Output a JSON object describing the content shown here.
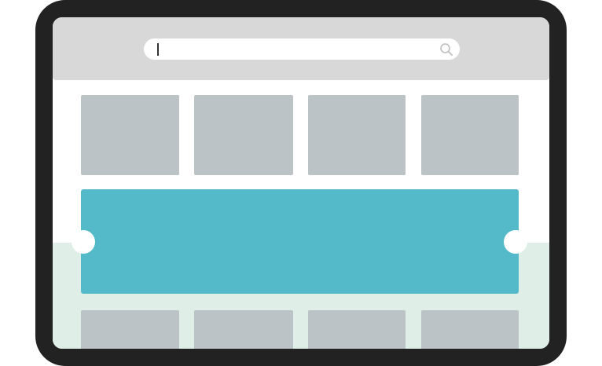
{
  "search": {
    "value": "",
    "placeholder": ""
  },
  "icons": {
    "search": "search-icon"
  },
  "colors": {
    "device_frame": "#222222",
    "header": "#d8d8d8",
    "tile": "#bcc3c6",
    "banner": "#54b9c9",
    "bottom_band": "#dfeee6"
  },
  "grid": {
    "top_row_tiles": 4,
    "bottom_row_tiles": 4
  }
}
